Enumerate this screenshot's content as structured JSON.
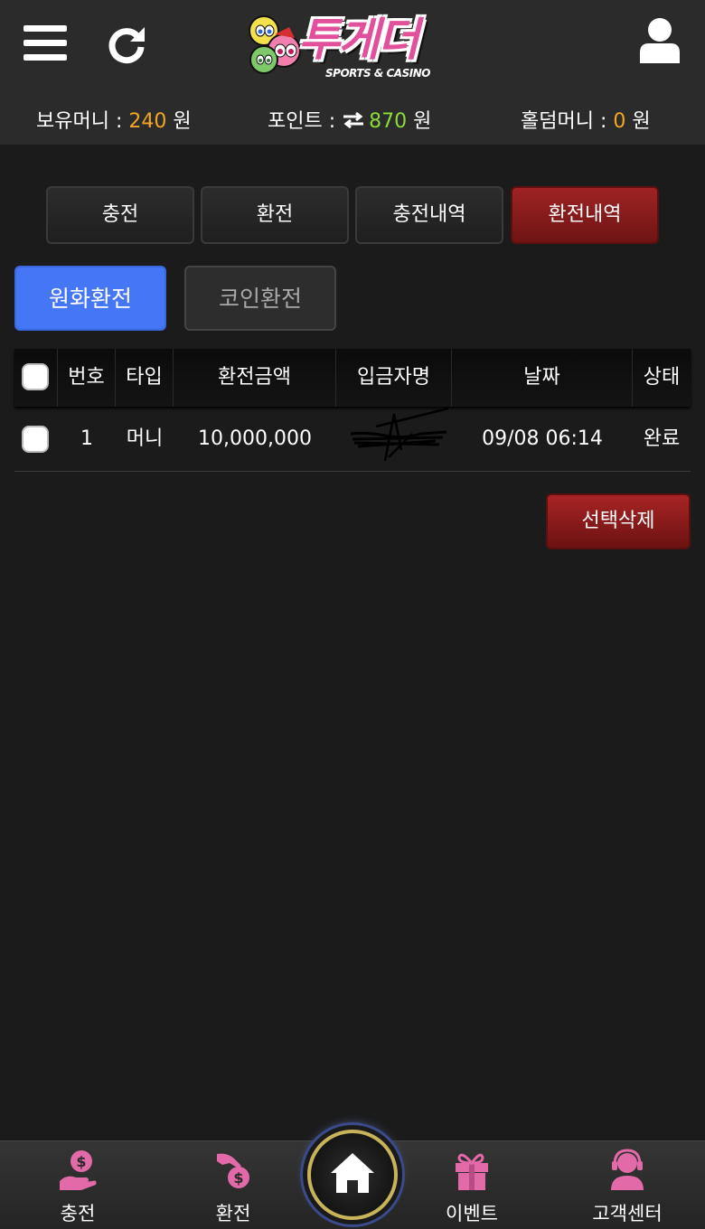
{
  "header": {
    "logo_text": "투게더",
    "logo_sub": "SPORTS & CASINO"
  },
  "balance": {
    "money_label": "보유머니 : ",
    "money_value": "240",
    "money_unit": " 원",
    "point_label": "포인트 : ",
    "point_value": "870",
    "point_unit": " 원",
    "hold_label": "홀덤머니 : ",
    "hold_value": "0",
    "hold_unit": " 원"
  },
  "main_tabs": [
    {
      "label": "충전"
    },
    {
      "label": "환전"
    },
    {
      "label": "충전내역"
    },
    {
      "label": "환전내역"
    }
  ],
  "sub_tabs": [
    {
      "label": "원화환전"
    },
    {
      "label": "코인환전"
    }
  ],
  "table": {
    "headers": [
      "번호",
      "타입",
      "환전금액",
      "입금자명",
      "날짜",
      "상태"
    ],
    "rows": [
      {
        "no": "1",
        "type": "머니",
        "amount": "10,000,000",
        "depositor": "",
        "date": "09/08 06:14",
        "status": "완료"
      }
    ]
  },
  "delete_button": "선택삭제",
  "bottom_nav": [
    {
      "label": "충전",
      "icon": "hand-coin-icon"
    },
    {
      "label": "환전",
      "icon": "exchange-coin-icon"
    },
    {
      "label": "",
      "icon": "home-icon"
    },
    {
      "label": "이벤트",
      "icon": "gift-icon"
    },
    {
      "label": "고객센터",
      "icon": "headset-agent-icon"
    }
  ],
  "colors": {
    "accent_blue": "#4476f5",
    "accent_red": "#8f1c1c",
    "money_orange": "#f5a623",
    "point_green": "#8bdc3a",
    "nav_pink": "#e26aa8"
  }
}
